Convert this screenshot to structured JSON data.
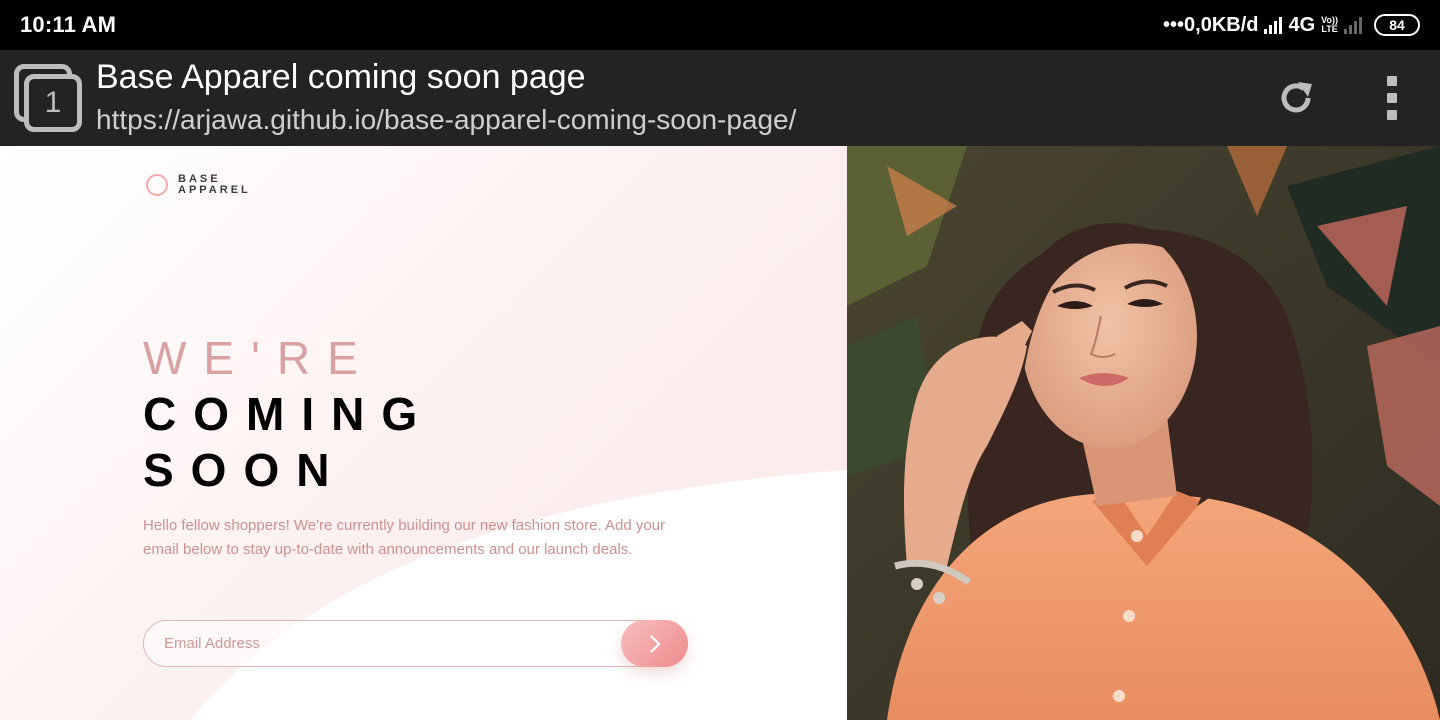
{
  "status_bar": {
    "time": "10:11 AM",
    "data_rate": "•••0,0KB/d",
    "network": "4G",
    "volte_top": "Vo))",
    "volte_bottom": "LTE",
    "battery": "84"
  },
  "browser": {
    "tab_count": "1",
    "page_title": "Base Apparel coming soon page",
    "url": "https://arjawa.github.io/base-apparel-coming-soon-page/"
  },
  "page": {
    "logo": {
      "line1": "BASE",
      "line2": "APPAREL"
    },
    "headline": {
      "light": "WE'RE",
      "line2": "COMING",
      "line3": "SOON"
    },
    "intro": "Hello fellow shoppers! We're currently building our new fashion store. Add your email below to stay up-to-date with announcements and our launch deals.",
    "email": {
      "placeholder": "Email Address",
      "value": ""
    },
    "colors": {
      "accent": "#ee8b8b",
      "soft_pink": "#ce9898",
      "text_dark": "#000000"
    },
    "hero_image": "woman-in-orange-shirt-photo"
  }
}
